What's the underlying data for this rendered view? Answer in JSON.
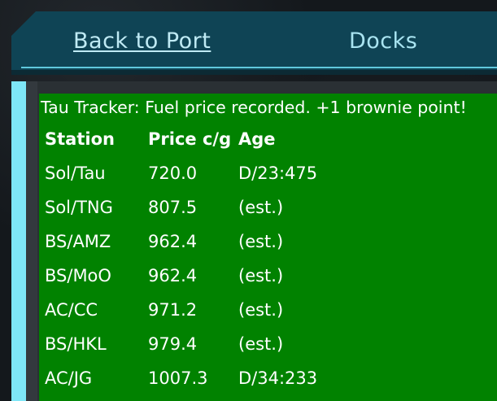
{
  "nav": {
    "back_label": "Back to Port",
    "docks_label": "Docks"
  },
  "status_message": "Tau Tracker: Fuel price recorded. +1 brownie point!",
  "table": {
    "headers": [
      "Station",
      "Price c/g",
      "Age"
    ],
    "rows": [
      {
        "station": "Sol/Tau",
        "price": "720.0",
        "age": "D/23:475"
      },
      {
        "station": "Sol/TNG",
        "price": "807.5",
        "age": "(est.)"
      },
      {
        "station": "BS/AMZ",
        "price": "962.4",
        "age": "(est.)"
      },
      {
        "station": "BS/MoO",
        "price": "962.4",
        "age": "(est.)"
      },
      {
        "station": "AC/CC",
        "price": "971.2",
        "age": "(est.)"
      },
      {
        "station": "BS/HKL",
        "price": "979.4",
        "age": "(est.)"
      },
      {
        "station": "AC/JG",
        "price": "1007.3",
        "age": "D/34:233"
      }
    ]
  },
  "colors": {
    "panel_bg": "#018200",
    "header_bg": "#0f4455",
    "accent": "#7ee6f7"
  }
}
